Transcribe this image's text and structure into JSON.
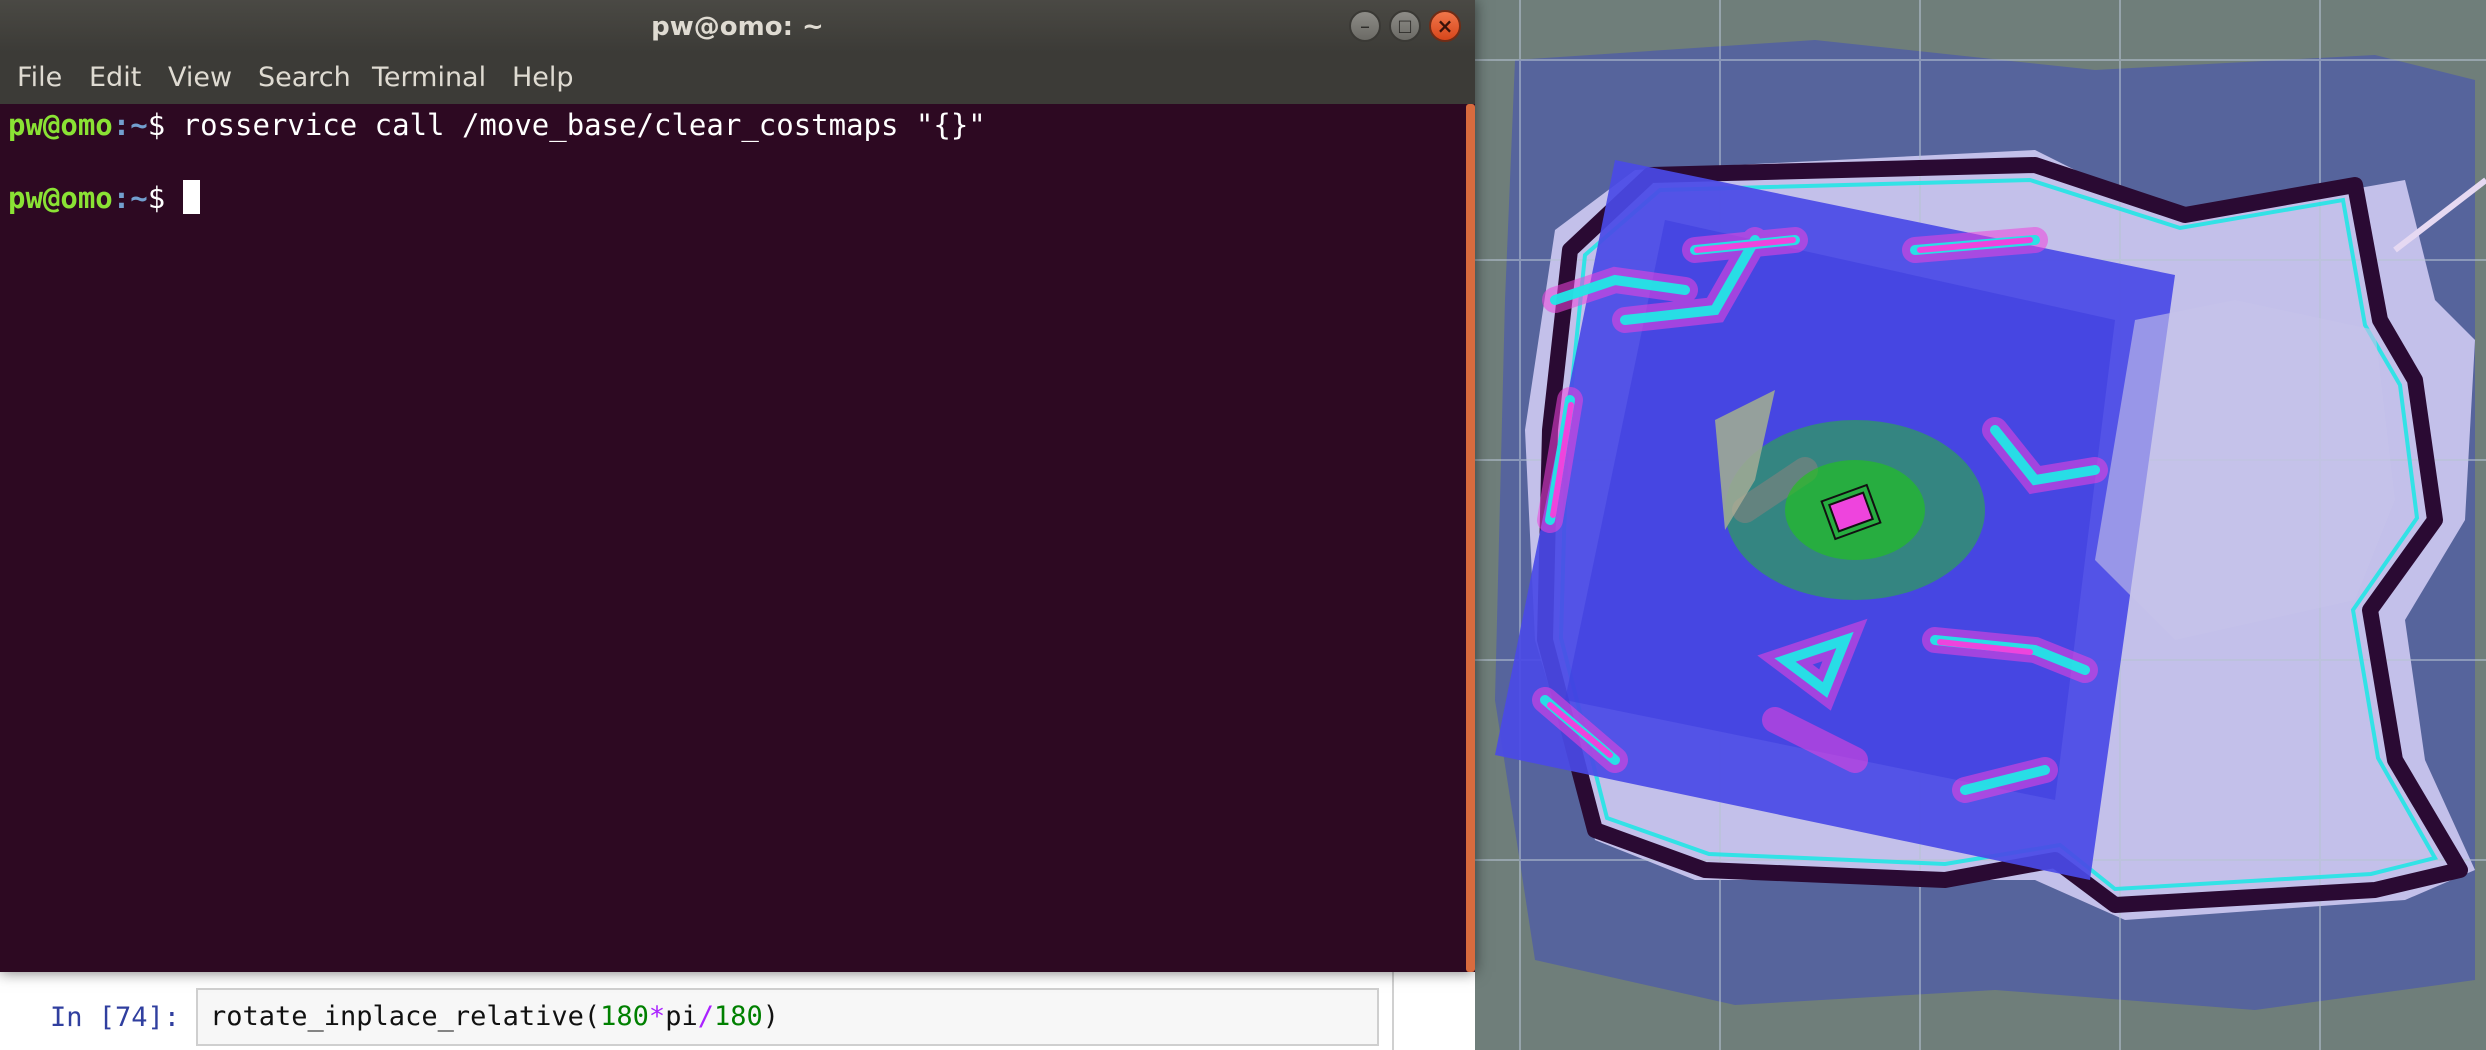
{
  "terminal": {
    "title": "pw@omo: ~",
    "menu": [
      "File",
      "Edit",
      "View",
      "Search",
      "Terminal",
      "Help"
    ],
    "lines": [
      {
        "user_host": "pw@omo",
        "path": ":~",
        "symbol": "$ ",
        "command": "rosservice call /move_base/clear_costmaps \"{}\""
      },
      {
        "user_host": "pw@omo",
        "path": ":~",
        "symbol": "$ ",
        "command": ""
      }
    ],
    "colors": {
      "background": "#2d0922",
      "prompt_user": "#8ae234",
      "prompt_path": "#729fcf",
      "scrollbar": "#d86b3e"
    }
  },
  "notebook": {
    "prompt": "In [74]:",
    "code": {
      "fn": "rotate_inplace_relative(",
      "n1": "180",
      "op1": "*",
      "var": "pi",
      "op2": "/",
      "n2": "180",
      "close": ")"
    }
  },
  "map": {
    "colors": {
      "free": "#c3c0ea",
      "costmap": "#4a4ae6",
      "unknown": "#56649c",
      "obstacle": "#2a0a33",
      "inflation": "#ee44dd",
      "lethal": "#22e6e6",
      "laser": "#22c41d",
      "grid": "#b7c4d4"
    }
  }
}
